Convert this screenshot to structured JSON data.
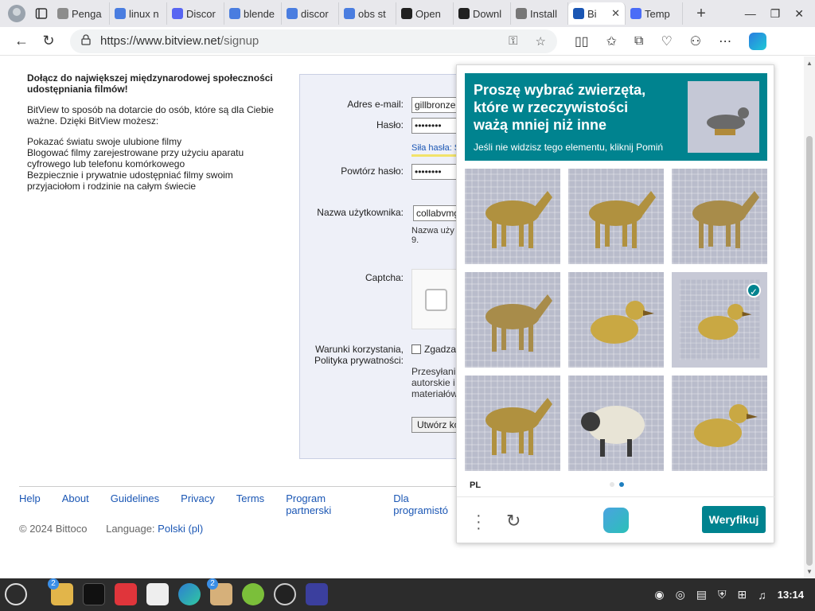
{
  "browser": {
    "tabs": [
      {
        "label": "Penga",
        "color": "#8c8c8c"
      },
      {
        "label": "linux n",
        "color": "#4a7de0"
      },
      {
        "label": "Discor",
        "color": "#5865f2"
      },
      {
        "label": "blende",
        "color": "#4a7de0"
      },
      {
        "label": "discor",
        "color": "#4a7de0"
      },
      {
        "label": "obs st",
        "color": "#4a7de0"
      },
      {
        "label": "Open",
        "color": "#202020"
      },
      {
        "label": "Downl",
        "color": "#202020"
      },
      {
        "label": "Install",
        "color": "#777777"
      },
      {
        "label": "Bi",
        "color": "#1a56b4",
        "active": true
      },
      {
        "label": "Temp",
        "color": "#4a6cf7"
      }
    ],
    "url": "https://www.bitview.net",
    "url_path": "/signup"
  },
  "intro": {
    "heading": "Dołącz do największej międzynarodowej społeczności udostępniania filmów!",
    "text1": "BitView to sposób na dotarcie do osób, które są dla Ciebie ważne. Dzięki BitView możesz:",
    "bullet1": "Pokazać światu swoje ulubione filmy",
    "bullet2": "Blogować filmy zarejestrowane przy użyciu aparatu cyfrowego lub telefonu komórkowego",
    "bullet3": "Bezpiecznie i prywatnie udostępniać filmy swoim przyjaciołom i rodzinie na całym świecie"
  },
  "form": {
    "email_label": "Adres e-mail:",
    "email_value": "gillbronze",
    "password_label": "Hasło:",
    "password_value": "••••••••",
    "strength_text": "Siła hasła: S",
    "repeat_label": "Powtórz hasło:",
    "repeat_value": "••••••••",
    "username_label": "Nazwa użytkownika:",
    "username_value": "collabvmg",
    "username_hint": "Nazwa uży",
    "username_hint2": "9.",
    "captcha_label": "Captcha:",
    "terms_label": "Warunki korzystania, Polityka prywatności:",
    "terms_check": "Zgadza",
    "terms_text": "Przesyłani autorskie i materiałów",
    "submit_label": "Utwórz ko"
  },
  "footer": {
    "links": [
      "Help",
      "About",
      "Guidelines",
      "Privacy",
      "Terms",
      "Program partnerski",
      "Dla programistó"
    ],
    "copyright": "© 2024 Bittoco",
    "language_label": "Language:",
    "language_value": "Polski (pl)"
  },
  "captcha": {
    "title": "Proszę wybrać zwierzęta, które w rzeczywistości ważą mniej niż inne",
    "hint": "Jeśli nie widzisz tego elementu, kliknij Pomiń",
    "language": "PL",
    "verify_label": "Weryfikuj",
    "cells": [
      {
        "animal": "horse",
        "selected": false
      },
      {
        "animal": "horse",
        "selected": false
      },
      {
        "animal": "bull",
        "selected": false
      },
      {
        "animal": "bull",
        "selected": false
      },
      {
        "animal": "duck",
        "selected": false
      },
      {
        "animal": "duck",
        "selected": true
      },
      {
        "animal": "horse",
        "selected": false
      },
      {
        "animal": "sheep",
        "selected": false
      },
      {
        "animal": "duck",
        "selected": false
      }
    ],
    "page_dots": [
      false,
      true
    ],
    "colors": {
      "accent": "#00838f"
    }
  },
  "taskbar": {
    "badge_files": "2",
    "badge_dev": "2",
    "time": "13:14"
  }
}
